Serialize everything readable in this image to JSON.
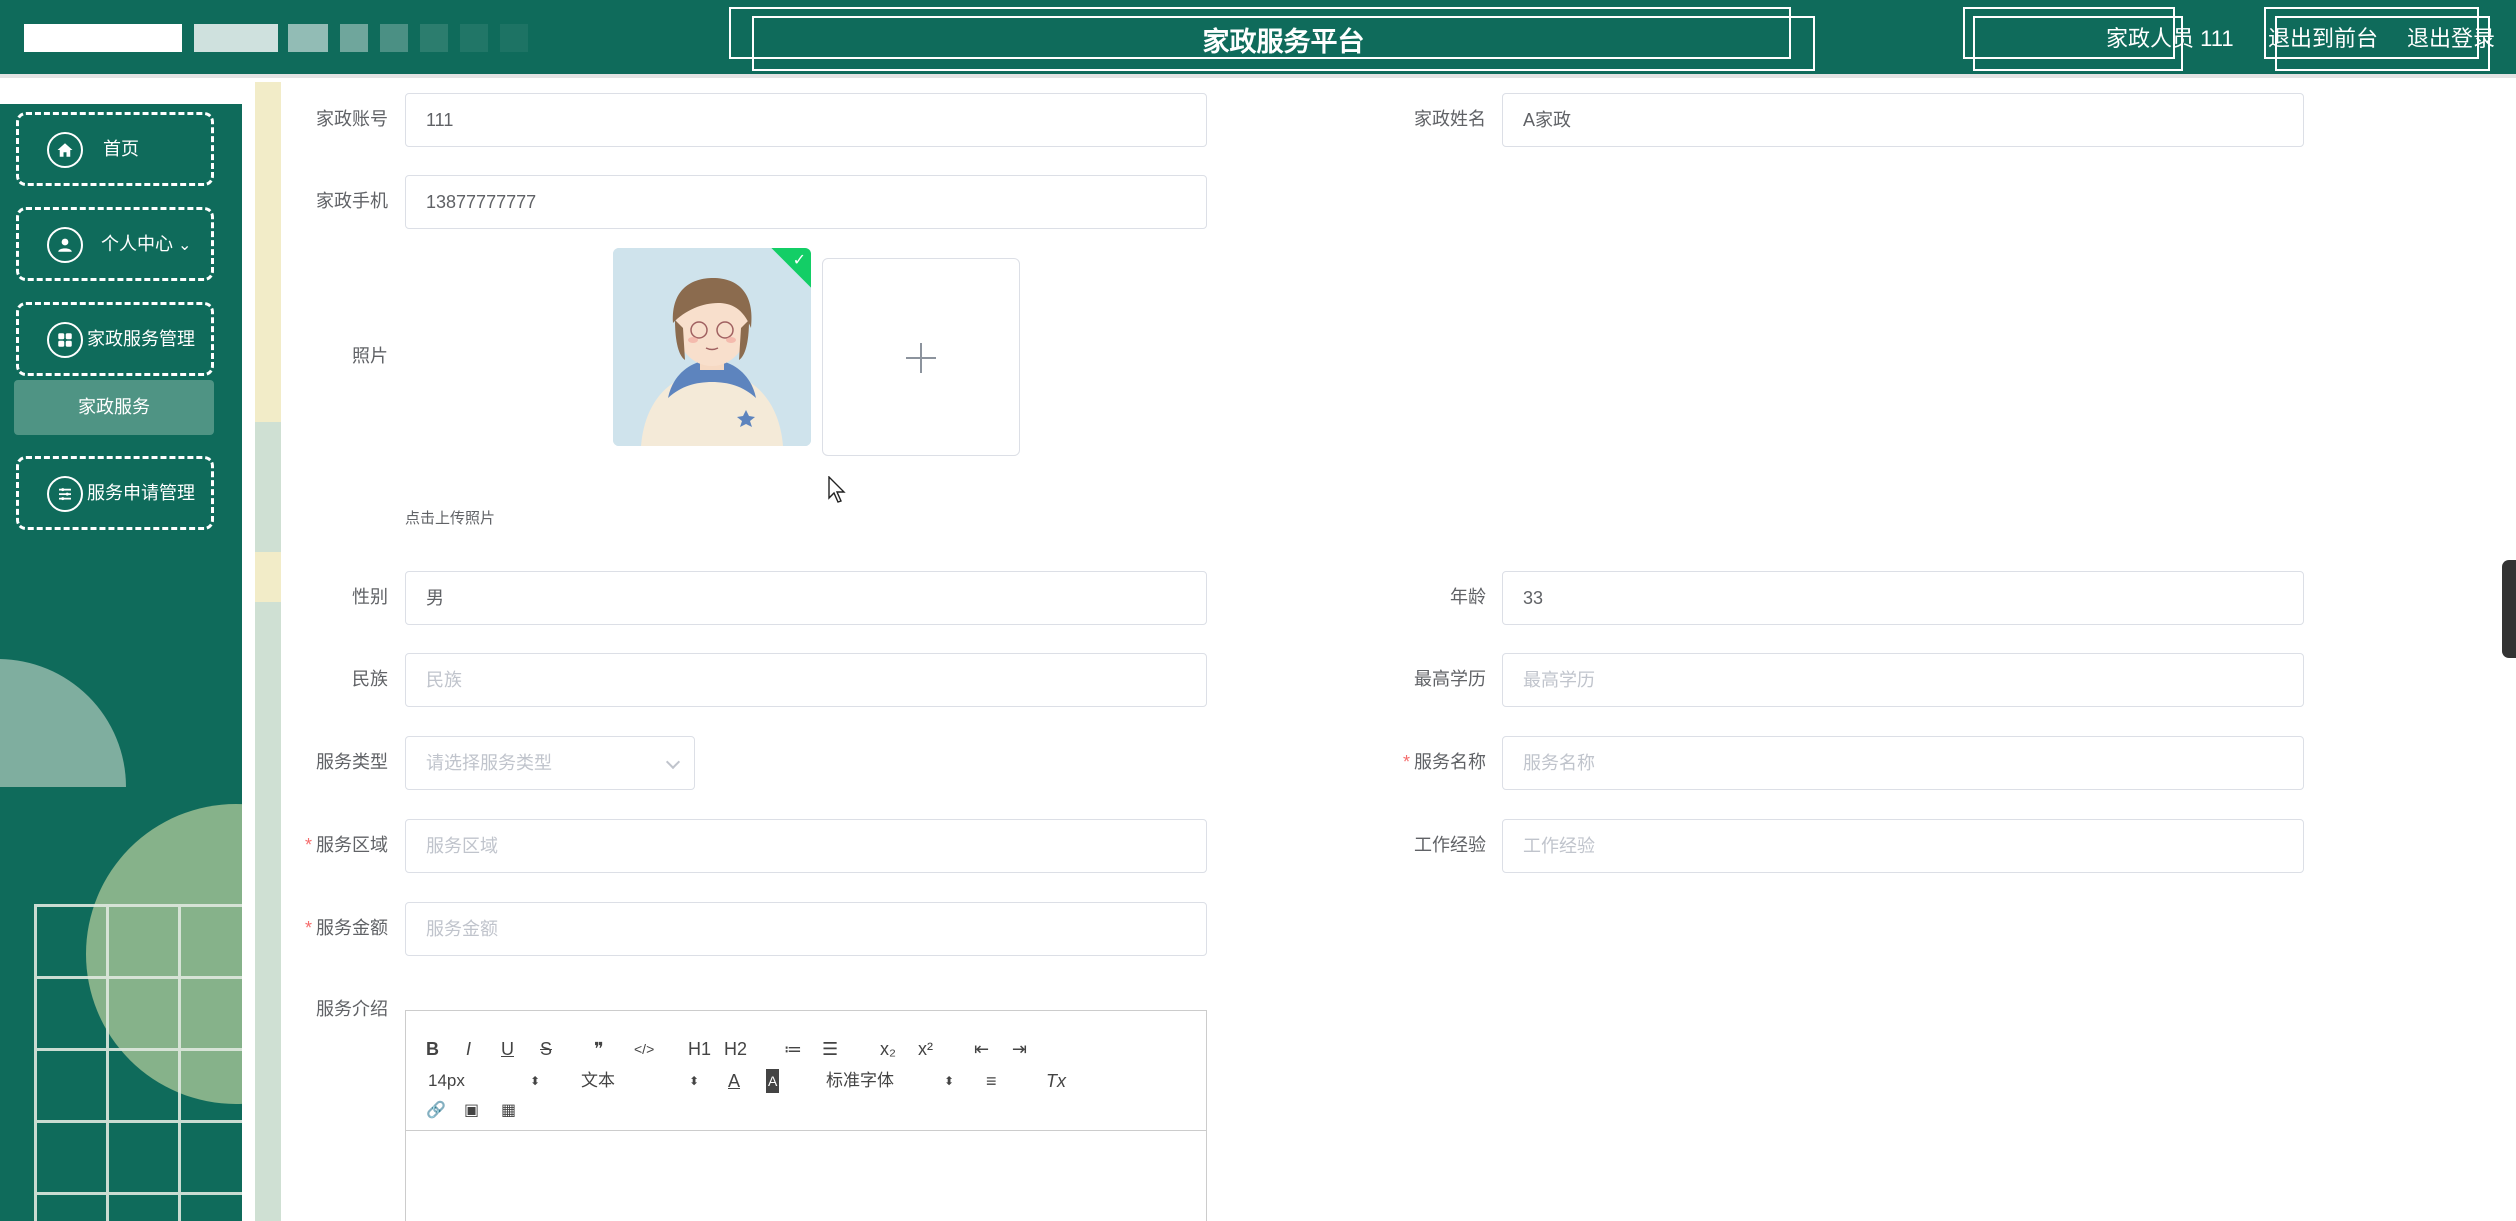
{
  "header": {
    "title": "家政服务平台",
    "user_label": "家政人员 111",
    "front_link": "退出到前台",
    "logout_link": "退出登录",
    "color": "#0f6b5b"
  },
  "sidebar": {
    "items": [
      {
        "label": "首页",
        "icon": "home-icon"
      },
      {
        "label": "个人中心",
        "icon": "user-icon",
        "expand": "⌄"
      },
      {
        "label": "家政服务管理",
        "icon": "grid-icon"
      },
      {
        "label": "服务申请管理",
        "icon": "list-icon"
      }
    ],
    "subitem": "家政服务"
  },
  "form": {
    "account": {
      "label": "家政账号",
      "value": "111"
    },
    "name": {
      "label": "家政姓名",
      "value": "A家政"
    },
    "phone": {
      "label": "家政手机",
      "value": "13877777777"
    },
    "photo": {
      "label": "照片",
      "tip": "点击上传照片"
    },
    "gender": {
      "label": "性别",
      "value": "男"
    },
    "age": {
      "label": "年龄",
      "value": "33"
    },
    "ethnicity": {
      "label": "民族",
      "placeholder": "民族"
    },
    "education": {
      "label": "最高学历",
      "placeholder": "最高学历"
    },
    "service_type": {
      "label": "服务类型",
      "placeholder": "请选择服务类型"
    },
    "service_name": {
      "label": "服务名称",
      "placeholder": "服务名称",
      "required": "*"
    },
    "service_area": {
      "label": "服务区域",
      "placeholder": "服务区域",
      "required": "*"
    },
    "experience": {
      "label": "工作经验",
      "placeholder": "工作经验"
    },
    "amount": {
      "label": "服务金额",
      "placeholder": "服务金额",
      "required": "*"
    },
    "intro": {
      "label": "服务介绍"
    }
  },
  "editor": {
    "row1": [
      "B",
      "I",
      "U",
      "S",
      "❞",
      "</>",
      "H1",
      "H2",
      "≔",
      "☰",
      "x₂",
      "x²",
      "⇤",
      "⇥"
    ],
    "font_size": "14px",
    "text_style": "文本",
    "font_family": "标准字体",
    "color_btn": "A",
    "bg_btn": "A",
    "align_btn": "≡",
    "clear_btn": "Tx",
    "select_arrow": "⬍",
    "row3": [
      "🔗",
      "▣",
      "▦"
    ]
  }
}
